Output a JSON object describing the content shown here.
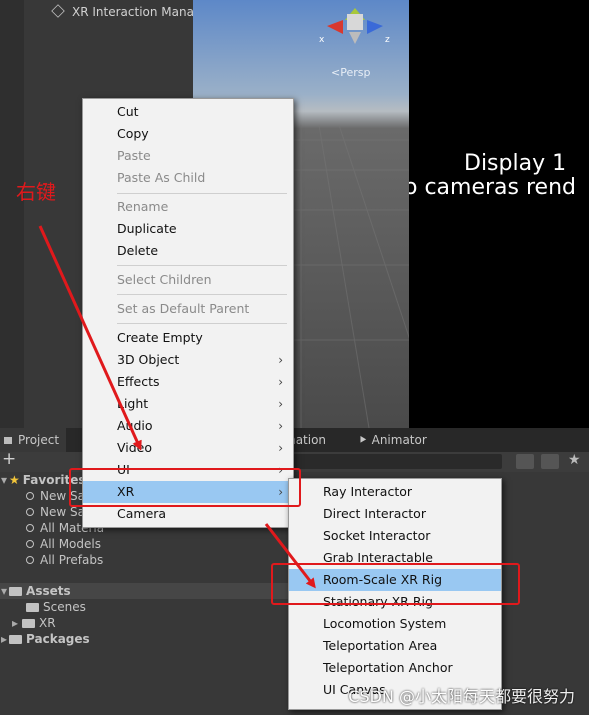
{
  "hierarchy": {
    "item": "XR Interaction Manag"
  },
  "scene": {
    "projection_label": "Persp",
    "axis_x": "x",
    "axis_z": "z"
  },
  "game": {
    "display_label": "Display 1",
    "message": "o cameras rend"
  },
  "project_panel": {
    "tabs": {
      "project": "Project",
      "animation": "mation",
      "animator": "Animator"
    },
    "toolbar_add": "+",
    "favorites": {
      "label": "Favorites",
      "items": [
        "New Sa",
        "New Sa",
        "All Materia",
        "All Models",
        "All Prefabs"
      ]
    },
    "assets": {
      "label": "Assets",
      "children": [
        "Scenes",
        "XR"
      ]
    },
    "packages": {
      "label": "Packages"
    }
  },
  "context_menu": {
    "group1": [
      "Cut",
      "Copy",
      "Paste",
      "Paste As Child"
    ],
    "group2": [
      "Rename",
      "Duplicate",
      "Delete"
    ],
    "group3": [
      "Select Children"
    ],
    "group4": [
      "Set as Default Parent"
    ],
    "group5": [
      "Create Empty",
      "3D Object",
      "Effects",
      "Light",
      "Audio",
      "Video",
      "UI",
      "XR",
      "Camera"
    ]
  },
  "submenu": [
    "Ray Interactor",
    "Direct Interactor",
    "Socket Interactor",
    "Grab Interactable",
    "Room-Scale XR Rig",
    "Stationary XR Rig",
    "Locomotion System",
    "Teleportation Area",
    "Teleportation Anchor",
    "UI Canvas"
  ],
  "annotation": {
    "label": "右键",
    "color": "#e0191c"
  },
  "watermark": "CSDN @小太阳每天都要很努力"
}
